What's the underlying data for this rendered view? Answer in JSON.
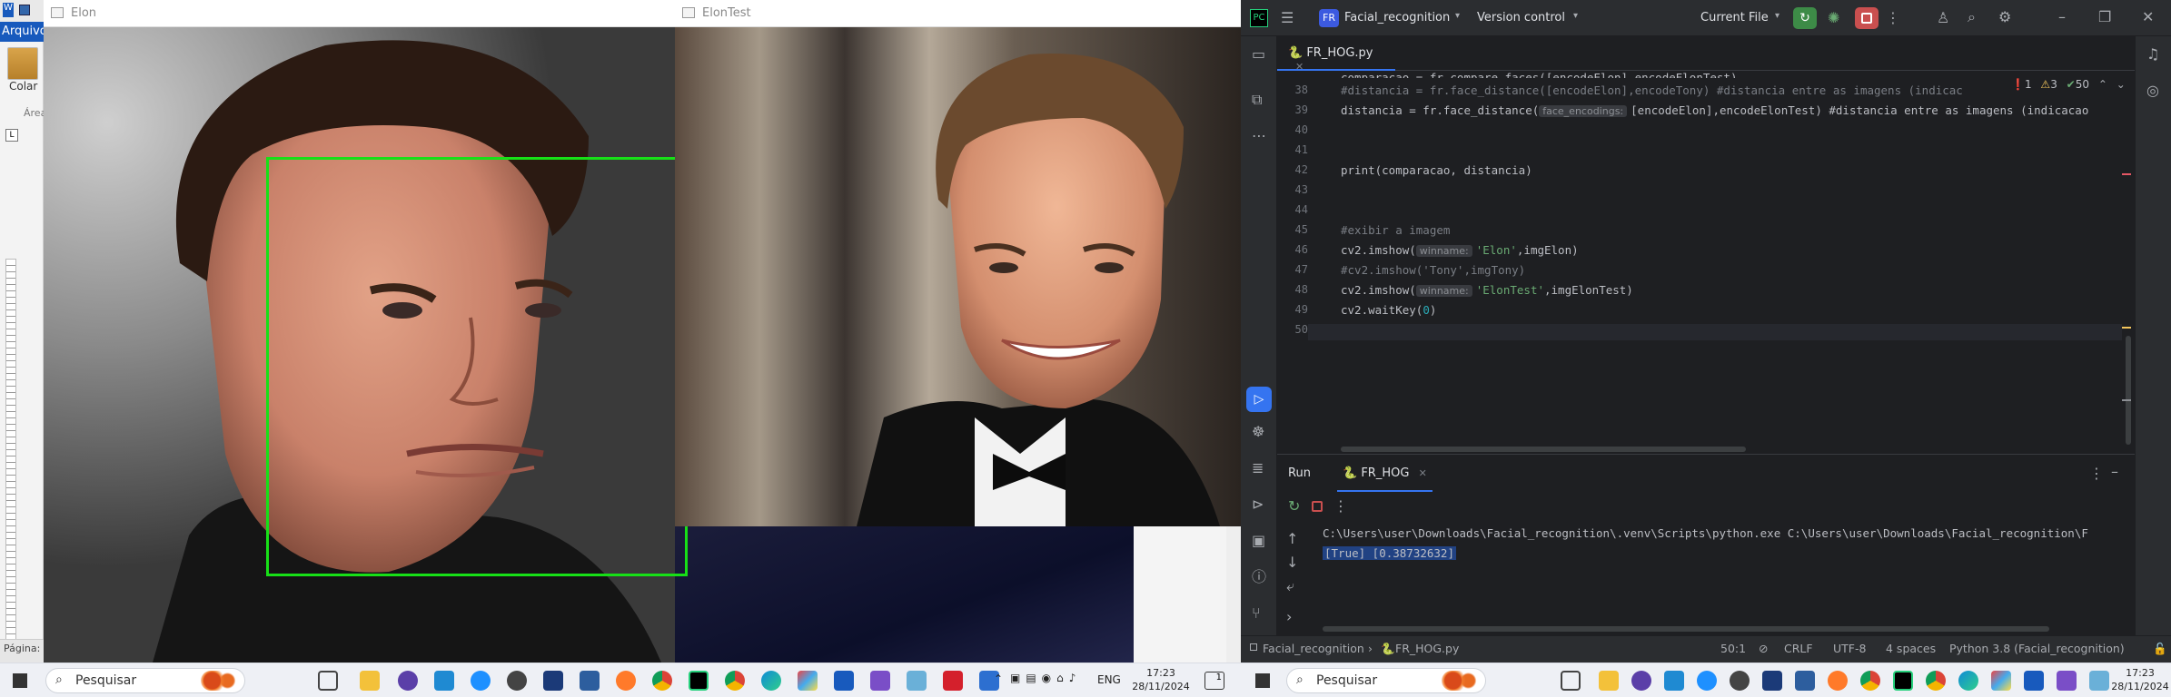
{
  "word": {
    "tab_label": "Arquivo",
    "paste_label": "Colar",
    "area_label": "Área",
    "page_label": "Página:",
    "tab_selector": "L"
  },
  "windows": {
    "elon_title": "Elon",
    "elontest_title": "ElonTest"
  },
  "ide": {
    "project_badge": "FR",
    "project_name": "Facial_recognition",
    "vcs": "Version control",
    "run_config": "Current File",
    "file_tab": "FR_HOG.py",
    "inspections": {
      "errors": "1",
      "warnings": "3",
      "ok": "50"
    },
    "code_lines": [
      {
        "n": "38",
        "text": "#distancia = fr.face_distance([encodeElon],encodeTony) #distancia entre as imagens (indicac"
      },
      {
        "n": "39",
        "pre": "distancia = fr.face_distance(",
        "hint": "face_encodings:",
        "post": "[encodeElon],encodeElonTest) #distancia entre as imagens (indicacao"
      },
      {
        "n": "40",
        "text": ""
      },
      {
        "n": "41",
        "text": ""
      },
      {
        "n": "42",
        "text": "print(comparacao, distancia)"
      },
      {
        "n": "43",
        "text": ""
      },
      {
        "n": "44",
        "text": ""
      },
      {
        "n": "45",
        "text": "#exibir a imagem"
      },
      {
        "n": "46",
        "pre": "cv2.imshow(",
        "hint": "winname:",
        "str": "'Elon'",
        "post": ",imgElon)"
      },
      {
        "n": "47",
        "text": "#cv2.imshow('Tony',imgTony)"
      },
      {
        "n": "48",
        "pre": "cv2.imshow(",
        "hint": "winname:",
        "str": "'ElonTest'",
        "post": ",imgElonTest)"
      },
      {
        "n": "49",
        "pre": "cv2.waitKey(",
        "num": "0",
        "post": ")"
      },
      {
        "n": "50",
        "text": ""
      }
    ],
    "run": {
      "tab": "Run",
      "config_tab": "FR_HOG",
      "cmd": "C:\\Users\\user\\Downloads\\Facial_recognition\\.venv\\Scripts\\python.exe C:\\Users\\user\\Downloads\\Facial_recognition\\F",
      "output": "[True] [0.38732632]"
    },
    "status": {
      "breadcrumb_project": "Facial_recognition",
      "breadcrumb_file": "FR_HOG.py",
      "position": "50:1",
      "line_sep": "CRLF",
      "encoding": "UTF-8",
      "indent": "4 spaces",
      "interpreter": "Python 3.8 (Facial_recognition)"
    }
  },
  "taskbar": {
    "search_placeholder": "Pesquisar",
    "lang": "ENG",
    "time": "17:23",
    "date": "28/11/2024",
    "notif_count": "1"
  },
  "colors": {
    "face_box": "#17e017",
    "ide_bg": "#1e1f22",
    "accent": "#3574f0"
  }
}
